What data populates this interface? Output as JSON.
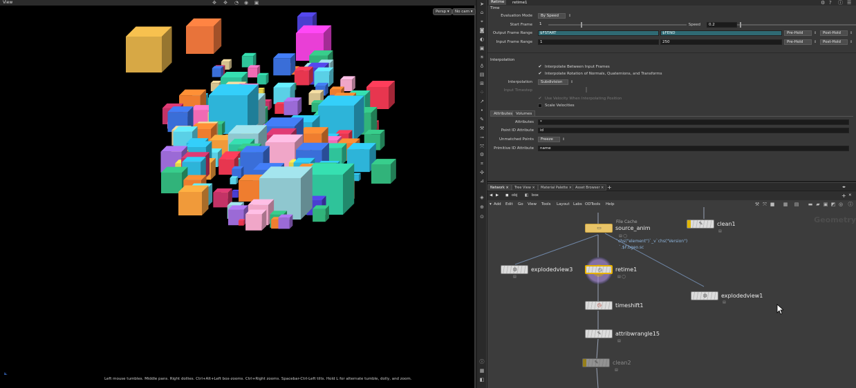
{
  "viewport": {
    "title": "View",
    "persp_label": "Persp",
    "cam_label": "No cam",
    "hint": "Left mouse tumbles. Middle pans. Right dollies. Ctrl+Alt+Left box-zooms. Ctrl+Right zooms. Spacebar-Ctrl-Left tilts. Hold L for alternate tumble, dolly, and zoom."
  },
  "params": {
    "node_type": "Retime",
    "node_name": "retime1",
    "section_time": "Time",
    "evaluation_mode_label": "Evaluation Mode",
    "evaluation_mode_value": "By Speed",
    "start_frame_label": "Start Frame",
    "start_frame_value": "1",
    "speed_label": "Speed",
    "speed_value": "0.2",
    "output_range_label": "Output Frame Range",
    "output_start": "$FSTART",
    "output_end": "$FEND",
    "pre_hold": "Pre-Hold",
    "post_hold": "Post-Hold",
    "input_range_label": "Input Frame Range",
    "input_start": "1",
    "input_end": "250",
    "section_interp": "Interpolation",
    "interp_between": "Interpolate Between Input Frames",
    "interp_rotation": "Interpolate Rotation of Normals, Quaternions, and Transforms",
    "interpolation_label": "Interpolation",
    "interpolation_value": "Subdivision",
    "input_timestep_label": "Input Timestep",
    "use_velocity": "Use Velocity When Interpolating Position",
    "scale_velocities": "Scale Velocities",
    "tab_attributes": "Attributes",
    "tab_volumes": "Volumes",
    "attributes_label": "Attributes",
    "attributes_value": "*",
    "point_id_label": "Point ID Attribute",
    "point_id_value": "id",
    "unmatched_label": "Unmatched Points",
    "unmatched_value": "Freeze",
    "prim_id_label": "Primitive ID Attribute",
    "prim_id_value": "name"
  },
  "network": {
    "tabs": [
      "Network",
      "Tree View",
      "Material Palette",
      "Asset Browser"
    ],
    "path_obj": "obj",
    "path_box": "box",
    "menu": [
      "Add",
      "Edit",
      "Go",
      "View",
      "Tools",
      "Layout",
      "Labs",
      "ODTools",
      "Help"
    ],
    "watermark": "Geometry",
    "nodes": {
      "filecache_type": "File Cache",
      "source_anim": "source_anim",
      "source_expr1": "`chs(\"element\")`_v`chs(\"Version\")",
      "source_expr2": "`.$F.bgeo.sc",
      "clean1": "clean1",
      "explodedview3": "explodedview3",
      "retime1": "retime1",
      "explodedview1": "explodedview1",
      "timeshift1": "timeshift1",
      "attribwrangle15": "attribwrangle15",
      "clean2": "clean2"
    }
  }
}
